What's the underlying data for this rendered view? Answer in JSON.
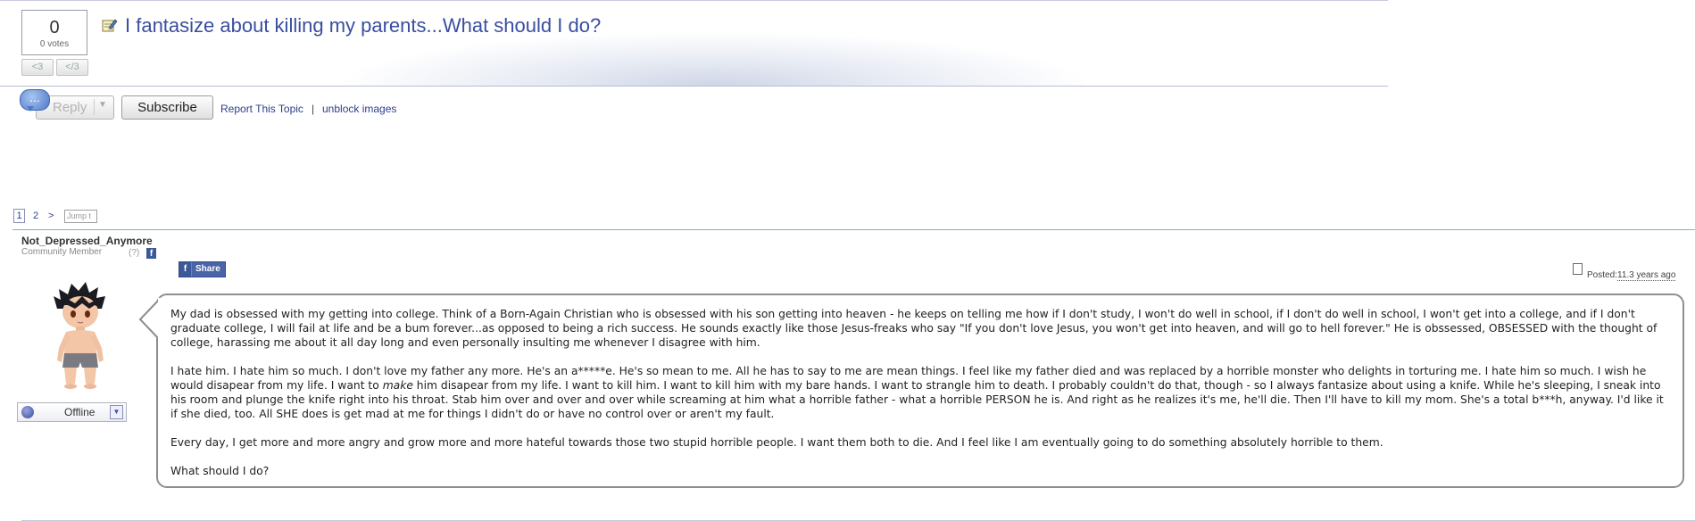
{
  "topic": {
    "votes": "0",
    "votes_label": "0 votes",
    "love_label": "<3",
    "unlove_label": "</3",
    "title": "I fantasize about killing my parents...What should I do?"
  },
  "actions": {
    "chat_label": "...",
    "reply_label": "Reply",
    "subscribe_label": "Subscribe",
    "report_label": "Report This Topic",
    "separator": "|",
    "unblock_label": "unblock images"
  },
  "pagination": {
    "current": "1",
    "page2": "2",
    "next": ">",
    "jump_placeholder": "Jump t"
  },
  "user": {
    "name": "Not_Depressed_Anymore",
    "rank": "Community Member",
    "help": "(?)",
    "status": "Offline"
  },
  "share": {
    "icon": "f",
    "label": "Share"
  },
  "post": {
    "posted_label": "Posted:",
    "posted_time": "11.3 years ago",
    "paragraphs": [
      "My dad is obsessed with my getting into college. Think of a Born-Again Christian who is obsessed with his son getting into heaven - he keeps on telling me how if I don't study, I won't do well in school, if I don't do well in school, I won't get into a college, and if I don't graduate college, I will fail at life and be a bum forever...as opposed to being a rich success. He sounds exactly like those Jesus-freaks who say \"If you don't love Jesus, you won't get into heaven, and will go to hell forever.\" He is obssessed, OBSESSED with the thought of college, harassing me about it all day long and even personally insulting me whenever I disagree with him.",
      "Every day, I get more and more angry and grow more and more hateful towards those two stupid horrible people. I want them both to die. And I feel like I am eventually going to do something absolutely horrible to them.",
      "What should I do?"
    ],
    "p2_a": "I hate him. I hate him so much. I don't love my father any more. He's an a*****e. He's so mean to me. All he has to say to me are mean things. I feel like my father died and was replaced by a horrible monster who delights in torturing me. I hate him so much. I wish he would disapear from my life. I want to ",
    "p2_em": "make",
    "p2_b": " him disapear from my life. I want to kill him. I want to kill him with my bare hands. I want to strangle him to death. I probably couldn't do that, though - so I always fantasize about using a knife. While he's sleeping, I sneak into his room and plunge the knife right into his throat. Stab him over and over and over while screaming at him what a horrible father - what a horrible PERSON he is. And right as he realizes it's me, he'll die. Then I'll have to kill my mom. She's a total b***h, anyway. I'd like it if she died, too. All SHE does is get mad at me for things I didn't do or have no control over or aren't my fault."
  },
  "icons": {
    "topic": "pencil-note-icon",
    "chat": "chat-bubble-icon",
    "dropdown": "chevron-down-icon",
    "status": "status-globe-icon",
    "posted": "document-icon"
  },
  "colors": {
    "link": "#2c3e8c",
    "title": "#3a4ea0",
    "divider": "#7fb8b8",
    "share": "#4a64a8"
  }
}
